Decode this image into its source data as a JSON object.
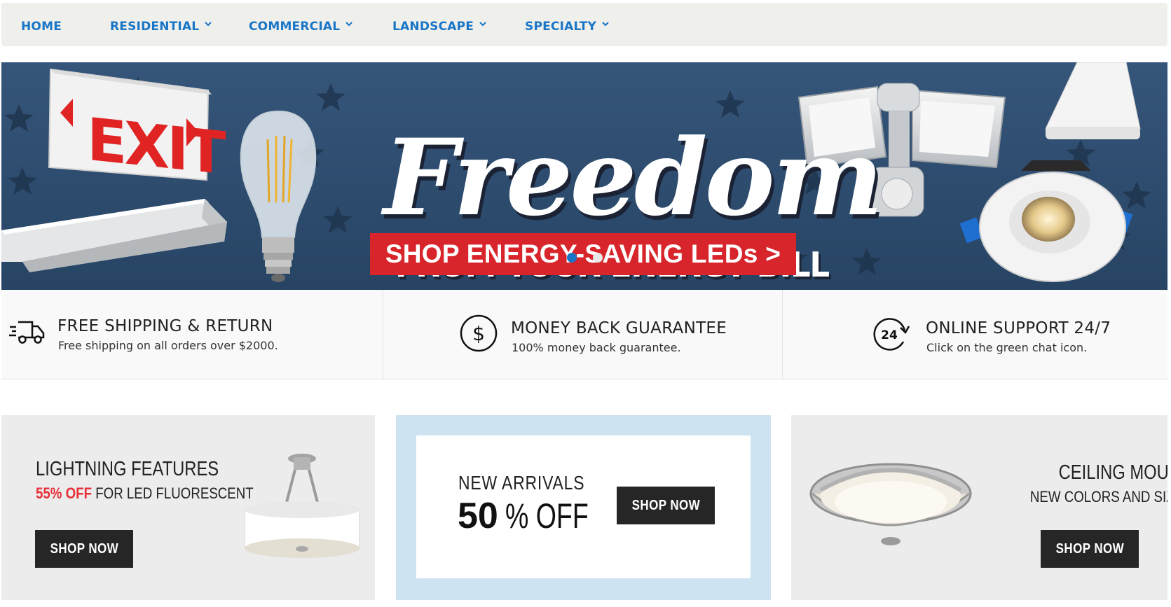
{
  "nav": {
    "items": [
      {
        "label": "HOME",
        "has_dropdown": false
      },
      {
        "label": "RESIDENTIAL",
        "has_dropdown": true
      },
      {
        "label": "COMMERCIAL",
        "has_dropdown": true
      },
      {
        "label": "LANDSCAPE",
        "has_dropdown": true
      },
      {
        "label": "SPECIALTY",
        "has_dropdown": true
      }
    ]
  },
  "hero": {
    "exit_sign_text": "EXIT",
    "headline": "Freedom",
    "subheadline": "FROM YOUR ENERGY BILL",
    "cta_label": "SHOP ENERGY-SAVING LEDs >",
    "slide_count": 2,
    "active_slide": 1
  },
  "features": [
    {
      "icon": "truck-icon",
      "title": "FREE SHIPPING & RETURN",
      "desc": "Free shipping on all orders over $2000."
    },
    {
      "icon": "dollar-circle-icon",
      "title": "MONEY BACK GUARANTEE",
      "desc": "100% money back guarantee."
    },
    {
      "icon": "support-24-icon",
      "title": "ONLINE SUPPORT 24/7",
      "desc": "Click on the green chat icon."
    }
  ],
  "promos": {
    "lighting": {
      "title": "LIGHTNING FEATURES",
      "sub_highlight": "55% OFF",
      "sub_rest": "FOR LED FLUORESCENT",
      "button": "SHOP NOW"
    },
    "arrivals": {
      "title": "NEW ARRIVALS",
      "big_number": "50",
      "big_rest": "% OFF",
      "button": "SHOP NOW"
    },
    "ceiling": {
      "title": "CEILING MOUNT",
      "subtitle": "NEW COLORS AND SIZES",
      "button": "SHOP NOW"
    }
  },
  "colors": {
    "nav_link": "#1976c7",
    "hero_bg": "#2d4a6b",
    "cta_red": "#d7252b",
    "highlight_red": "#e8303a",
    "button_dark": "#262626",
    "arrivals_frame": "#cde3f1"
  }
}
